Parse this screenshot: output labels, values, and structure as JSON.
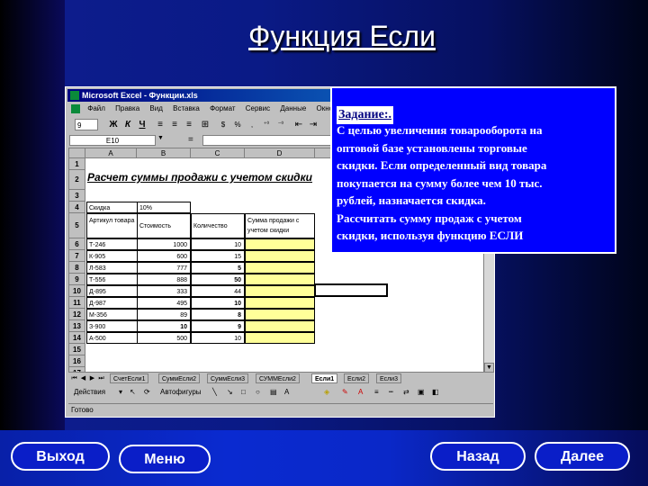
{
  "slide": {
    "title": "Функция Если"
  },
  "excel": {
    "window_title": "Microsoft Excel - Функции.xls",
    "menu": [
      "Файл",
      "Правка",
      "Вид",
      "Вставка",
      "Формат",
      "Сервис",
      "Данные",
      "Окно",
      "?"
    ],
    "font_size": "9",
    "format_buttons": [
      "Ж",
      "К",
      "Ч"
    ],
    "name_box": "E10",
    "formula_eq": "=",
    "col_headers": [
      "A",
      "B",
      "C",
      "D"
    ],
    "row_numbers": [
      "1",
      "2",
      "3",
      "4",
      "5",
      "6",
      "7",
      "8",
      "9",
      "10",
      "11",
      "12",
      "13",
      "14",
      "15",
      "16",
      "17"
    ],
    "sheet_title": "Расчет суммы продажи с учетом скидки",
    "discount_label": "Скидка",
    "discount_value": "10%",
    "table_headers": [
      "Артикул товара",
      "Стоимость",
      "Количество",
      "Сумма продажи с учетом скидки"
    ],
    "rows": [
      {
        "article": "Т-246",
        "price": "1000",
        "qty": "10"
      },
      {
        "article": "К-905",
        "price": "600",
        "qty": "15"
      },
      {
        "article": "Л-583",
        "price": "777",
        "qty": "5"
      },
      {
        "article": "Т-556",
        "price": "888",
        "qty": "50"
      },
      {
        "article": "Д-895",
        "price": "333",
        "qty": "44"
      },
      {
        "article": "Д-987",
        "price": "495",
        "qty": "10"
      },
      {
        "article": "М-356",
        "price": "89",
        "qty": "8"
      },
      {
        "article": "З-900",
        "price": "10",
        "qty": "9"
      },
      {
        "article": "А-500",
        "price": "500",
        "qty": "10"
      }
    ],
    "sheet_tabs": [
      "СчетЕсли1",
      "СуммЕсли2",
      "СуммЕсли3",
      "СУММЕсли2",
      "Если1",
      "Если2",
      "Если3"
    ],
    "active_tab": "Если1",
    "drawing_label": "Действия",
    "autoshapes_label": "Автофигуры",
    "status": "Готово"
  },
  "task": {
    "title": "Задание:.",
    "lines": [
      "С целью увеличения товарооборота на",
      "оптовой базе установлены торговые",
      "скидки. Если определенный вид товара",
      "покупается на сумму более чем 10 тыс.",
      "рублей, назначается скидка.",
      "Рассчитать сумму продаж с учетом",
      "скидки, используя функцию ЕСЛИ"
    ]
  },
  "nav": {
    "exit": "Выход",
    "menu": "Меню",
    "back": "Назад",
    "next": "Далее"
  }
}
